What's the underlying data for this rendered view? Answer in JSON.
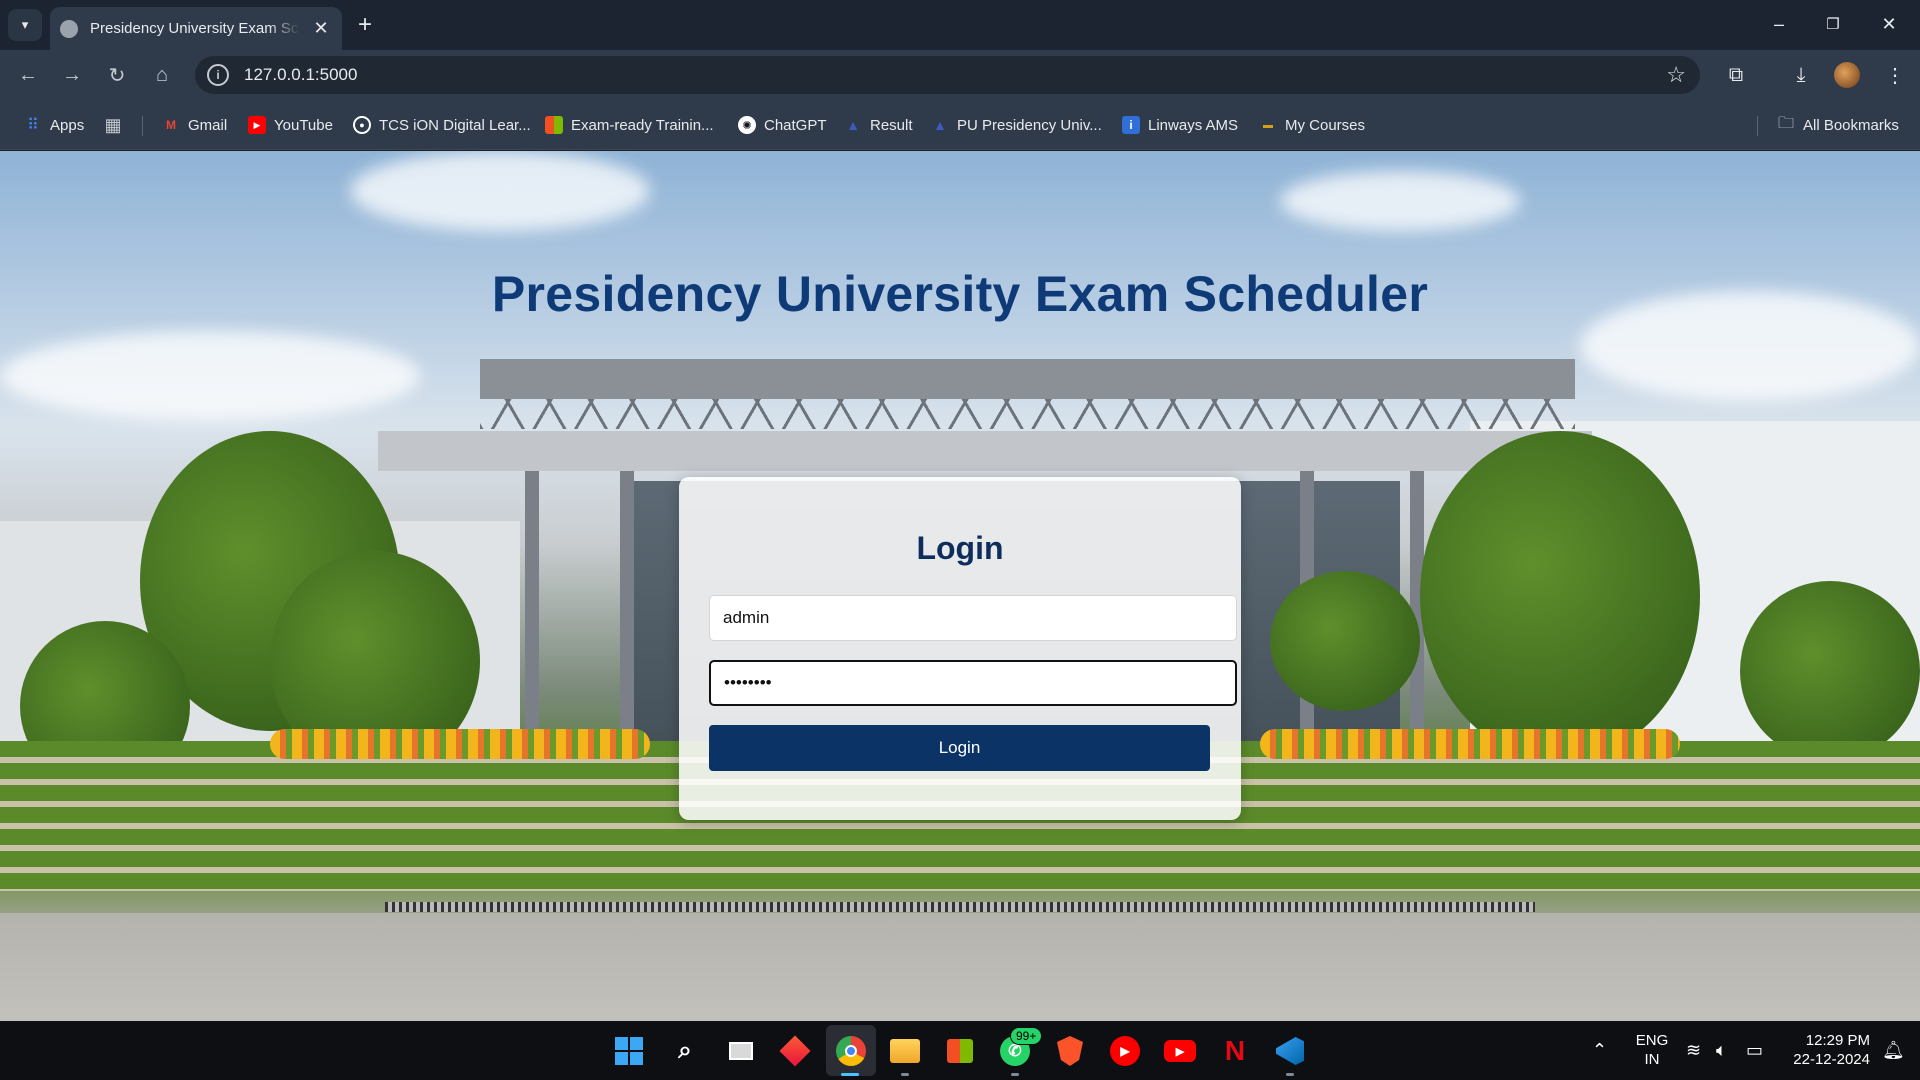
{
  "browser": {
    "tab": {
      "title": "Presidency University Exam Scheduler",
      "close_icon": "close-icon"
    },
    "new_tab_label": "+",
    "window_controls": {
      "minimize": "–",
      "restore": "❐",
      "close": "✕"
    },
    "address_bar": {
      "url": "127.0.0.1:5000"
    },
    "bookmarks": [
      {
        "label": "Apps",
        "icon": "apps-grid-icon",
        "color": "#4285f4"
      },
      {
        "label": "Gmail",
        "icon": "gmail-icon",
        "color": "#ea4335"
      },
      {
        "label": "YouTube",
        "icon": "youtube-icon",
        "color": "#ff0000"
      },
      {
        "label": "TCS iON Digital Lear...",
        "icon": "tcs-ion-icon",
        "color": "#ffffff"
      },
      {
        "label": "Exam-ready Trainin...",
        "icon": "microsoft-icon",
        "color": "#f25022"
      },
      {
        "label": "ChatGPT",
        "icon": "chatgpt-icon",
        "color": "#ffffff"
      },
      {
        "label": "Result",
        "icon": "result-icon",
        "color": "#2b4ba3"
      },
      {
        "label": "PU Presidency Univ...",
        "icon": "presidency-icon",
        "color": "#2b4ba3"
      },
      {
        "label": "Linways AMS",
        "icon": "linways-icon",
        "color": "#2f6fd6"
      },
      {
        "label": "My Courses",
        "icon": "courses-icon",
        "color": "#d4a017"
      }
    ],
    "all_bookmarks_label": "All Bookmarks"
  },
  "page": {
    "title": "Presidency University Exam Scheduler",
    "login": {
      "heading": "Login",
      "username_value": "admin",
      "password_value": "••••••••",
      "button_label": "Login"
    }
  },
  "taskbar": {
    "whatsapp_badge": "99+",
    "language": {
      "line1": "ENG",
      "line2": "IN"
    },
    "clock": {
      "time": "12:29 PM",
      "date": "22-12-2024"
    }
  },
  "colors": {
    "title": "#0f3a78",
    "login_heading": "#0e2d5c",
    "login_button": "#0c3366"
  }
}
